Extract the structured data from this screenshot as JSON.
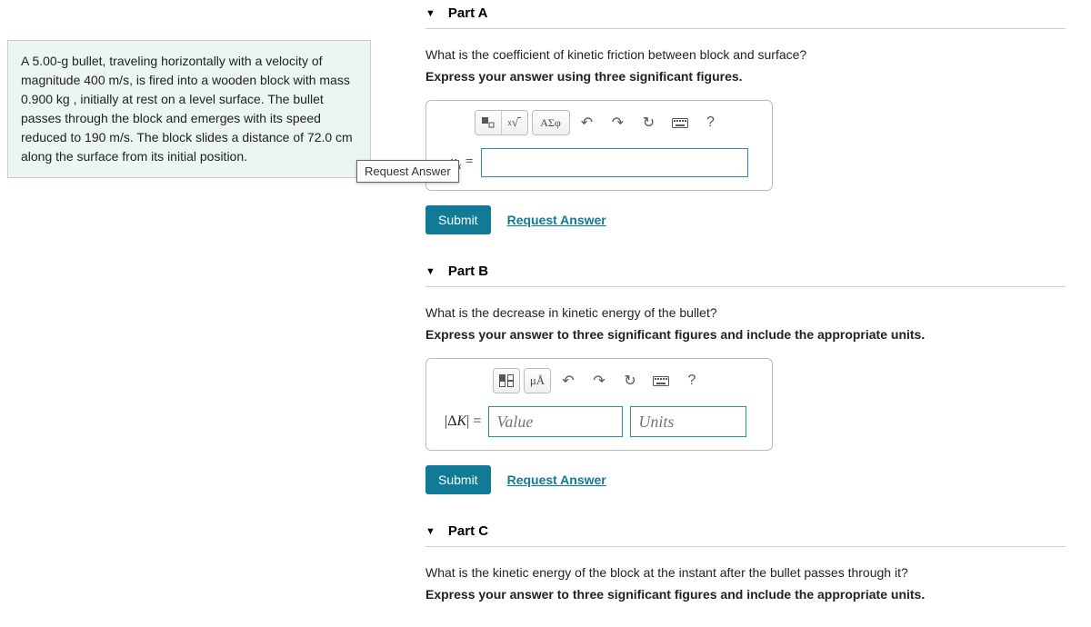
{
  "problem_text": "A 5.00-g bullet, traveling horizontally with a velocity of magnitude 400 m/s, is fired into a wooden block with mass 0.900  kg , initially at rest on a level surface. The bullet passes through the block and emerges with its speed reduced to 190 m/s. The block slides a distance of 72.0 cm along the surface from its initial position.",
  "tooltip": "Request Answer",
  "parts": {
    "a": {
      "title": "Part A",
      "question": "What is the coefficient of kinetic friction between block and surface?",
      "instruction": "Express your answer using three significant figures.",
      "var_html": "μ<span class='sub'>k</span> =",
      "toolbar": {
        "greek": "ΑΣφ"
      },
      "submit": "Submit",
      "request": "Request Answer"
    },
    "b": {
      "title": "Part B",
      "question": "What is the decrease in kinetic energy of the bullet?",
      "instruction": "Express your answer to three significant figures and include the appropriate units.",
      "var_label": "|ΔK| =",
      "value_placeholder": "Value",
      "units_placeholder": "Units",
      "toolbar": {
        "units": "μÅ"
      },
      "submit": "Submit",
      "request": "Request Answer"
    },
    "c": {
      "title": "Part C",
      "question": "What is the kinetic energy of the block at the instant after the bullet passes through it?",
      "instruction": "Express your answer to three significant figures and include the appropriate units."
    }
  },
  "help": "?"
}
